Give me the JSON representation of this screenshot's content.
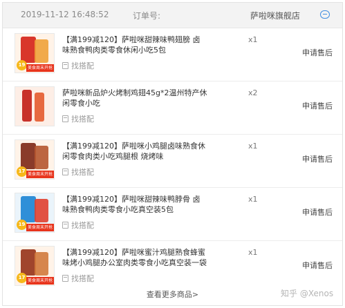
{
  "header": {
    "datetime": "2019-11-12 16:48:52",
    "order_label": "订单号:",
    "shop_name": "萨啦咪旗舰店"
  },
  "items": [
    {
      "title": "【满199减120】萨啦咪甜辣味鸭翅膀 卤味熟食鸭肉类零食休闲小吃5包",
      "match_label": "找搭配",
      "qty": "x1",
      "action": "申请售后",
      "badge": "19",
      "banner": "美食周末开抢",
      "colors": [
        "#d9362b",
        "#f0a23a"
      ]
    },
    {
      "title": "萨啦咪新品炉火烤制鸡翅45g*2温州特产休闲零食小吃",
      "match_label": "找搭配",
      "qty": "x2",
      "action": "申请售后",
      "badge": "",
      "banner": "",
      "colors": [
        "#c8312a",
        "#e45a2e"
      ]
    },
    {
      "title": "【满199减120】萨啦咪小鸡腿卤味熟食休闲零食肉类小吃鸡腿根 烧烤味",
      "match_label": "找搭配",
      "qty": "x1",
      "action": "申请售后",
      "badge": "17",
      "banner": "美食周末开抢",
      "colors": [
        "#8a3b2a",
        "#b5572f"
      ]
    },
    {
      "title": "【满199减120】萨啦咪甜辣味鸭脖骨 卤味熟食鸭肉类零食小吃真空装5包",
      "match_label": "找搭配",
      "qty": "x1",
      "action": "申请售后",
      "badge": "19",
      "banner": "美食周末开抢",
      "colors": [
        "#2f8fd8",
        "#e0402f"
      ]
    },
    {
      "title": "【满199减120】萨啦咪蜜汁鸡腿熟食蜂蜜味烤小鸡腿办公室肉类零食小吃真空装一袋",
      "match_label": "找搭配",
      "qty": "x1",
      "action": "申请售后",
      "badge": "17",
      "banner": "美食周末开抢",
      "colors": [
        "#a0452c",
        "#d27a3c"
      ]
    }
  ],
  "footer": {
    "more_label": "查看更多商品>",
    "watermark": "知乎 @Xenos"
  }
}
